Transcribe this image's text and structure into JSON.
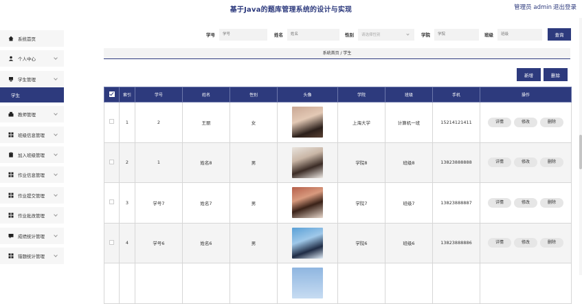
{
  "header": {
    "title": "基于Java的题库管理系统的设计与实现",
    "user": "管理员 admin",
    "logout": "退出登录"
  },
  "sidebar": {
    "items": [
      {
        "label": "系统首页",
        "icon": "home-icon",
        "chevron": false
      },
      {
        "label": "个人中心",
        "icon": "user-icon",
        "chevron": true
      },
      {
        "label": "学生管理",
        "icon": "student-icon",
        "chevron": true,
        "expanded": true,
        "sub": [
          "学生"
        ]
      },
      {
        "label": "教师管理",
        "icon": "teacher-icon",
        "chevron": true
      },
      {
        "label": "班级信息管理",
        "icon": "grid-icon",
        "chevron": true
      },
      {
        "label": "加入班级管理",
        "icon": "clipboard-icon",
        "chevron": true
      },
      {
        "label": "作业信息管理",
        "icon": "grid-icon",
        "chevron": true
      },
      {
        "label": "作业提交管理",
        "icon": "grid-icon",
        "chevron": true
      },
      {
        "label": "作业批改管理",
        "icon": "grid-icon",
        "chevron": true
      },
      {
        "label": "成绩统计管理",
        "icon": "chat-icon",
        "chevron": true
      },
      {
        "label": "错题统计管理",
        "icon": "grid-icon",
        "chevron": true
      }
    ]
  },
  "search": {
    "fields": [
      {
        "label": "学号",
        "placeholder": "学号"
      },
      {
        "label": "姓名",
        "placeholder": "姓名"
      },
      {
        "label": "性别",
        "placeholder": "请选择性别",
        "select": true
      },
      {
        "label": "学院",
        "placeholder": "学院"
      },
      {
        "label": "班级",
        "placeholder": "班级"
      }
    ],
    "button": "查询"
  },
  "breadcrumb": "系统首页 / 学生",
  "toolbar": {
    "add": "新增",
    "delete": "删除"
  },
  "table": {
    "headers": [
      "",
      "索引",
      "学号",
      "姓名",
      "性别",
      "头像",
      "学院",
      "班级",
      "手机",
      "操作"
    ],
    "rows": [
      {
        "index": "1",
        "id": "2",
        "name": "王丽",
        "gender": "女",
        "avatar": "av1",
        "college": "上海大学",
        "class": "计算机一班",
        "phone": "15214121411"
      },
      {
        "index": "2",
        "id": "1",
        "name": "姓名8",
        "gender": "男",
        "avatar": "av2",
        "college": "学院8",
        "class": "班级8",
        "phone": "13823888888"
      },
      {
        "index": "3",
        "id": "学号7",
        "name": "姓名7",
        "gender": "男",
        "avatar": "av3",
        "college": "学院7",
        "class": "班级7",
        "phone": "13823888887"
      },
      {
        "index": "4",
        "id": "学号6",
        "name": "姓名6",
        "gender": "男",
        "avatar": "av4",
        "college": "学院6",
        "class": "班级6",
        "phone": "13823888886"
      },
      {
        "index": "",
        "id": "",
        "name": "",
        "gender": "",
        "avatar": "av5",
        "college": "",
        "class": "",
        "phone": ""
      }
    ],
    "ops": [
      "详情",
      "修改",
      "删除"
    ]
  }
}
